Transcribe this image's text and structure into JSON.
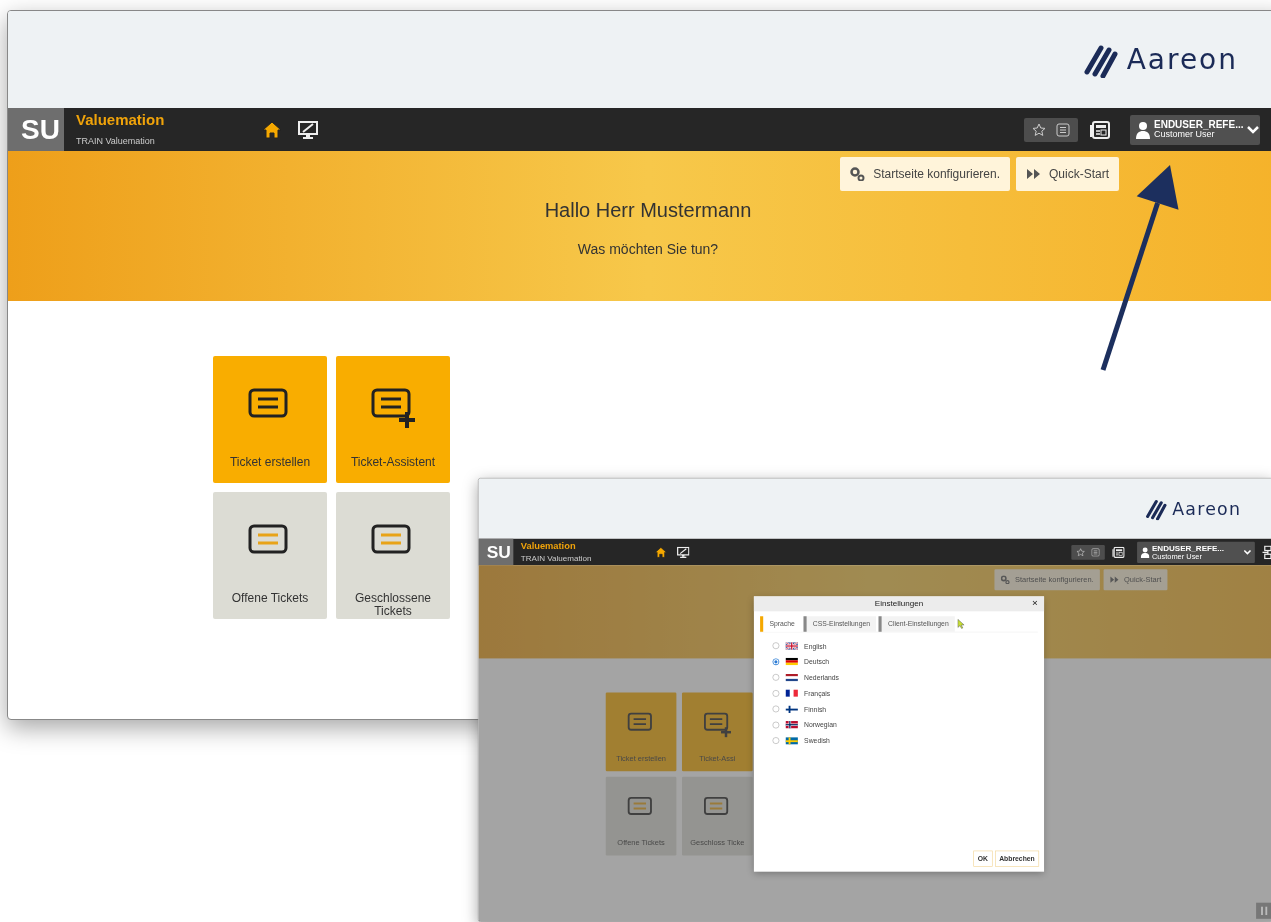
{
  "windows": [
    {
      "kind": "full",
      "header": {
        "logo_text": "Aareon"
      },
      "navbar": {
        "logo": "SU",
        "app_name": "Valuemation",
        "app_subtitle": "TRAIN Valuemation",
        "user_name": "ENDUSER_REFE...",
        "user_role": "Customer User"
      },
      "banner": {
        "buttons": [
          "Startseite konfigurieren.",
          "Quick-Start"
        ],
        "greeting": "Hallo Herr Mustermann",
        "question": "Was möchten Sie tun?"
      },
      "tiles": [
        {
          "label": "Ticket erstellen",
          "kind": "create"
        },
        {
          "label": "Ticket-Assistent",
          "kind": "assistant"
        },
        {
          "label": "Offene Tickets",
          "kind": "open"
        },
        {
          "label": "Geschlossene Tickets",
          "kind": "closed"
        }
      ]
    },
    {
      "kind": "thumbnail",
      "header": {
        "logo_text": "Aareon"
      },
      "navbar": {
        "logo": "SU",
        "app_name": "Valuemation",
        "app_subtitle": "TRAIN Valuemation",
        "user_name": "ENDUSER_REFE...",
        "user_role": "Customer User"
      },
      "banner": {
        "buttons": [
          "Startseite konfigurieren.",
          "Quick-Start"
        ]
      },
      "tiles": [
        {
          "label": "Ticket erstellen",
          "kind": "create"
        },
        {
          "label": "Ticket-Assi",
          "kind": "assistant"
        },
        {
          "label": "Offene Tickets",
          "kind": "open"
        },
        {
          "label": "Geschloss Ticke",
          "kind": "closed"
        }
      ],
      "dialog": {
        "title": "Einstellungen",
        "close": "×",
        "tabs": [
          {
            "label": "Sprache",
            "selected": true
          },
          {
            "label": "CSS-Einstellungen",
            "selected": false
          },
          {
            "label": "Client-Einstellungen",
            "selected": false
          }
        ],
        "options": [
          {
            "label": "English",
            "selected": false
          },
          {
            "label": "Deutsch",
            "selected": true
          },
          {
            "label": "Nederlands",
            "selected": false
          },
          {
            "label": "Français",
            "selected": false
          },
          {
            "label": "Finnish",
            "selected": false
          },
          {
            "label": "Norwegian",
            "selected": false
          },
          {
            "label": "Swedish",
            "selected": false
          }
        ],
        "buttons": [
          "OK",
          "Abbrechen"
        ]
      }
    }
  ]
}
